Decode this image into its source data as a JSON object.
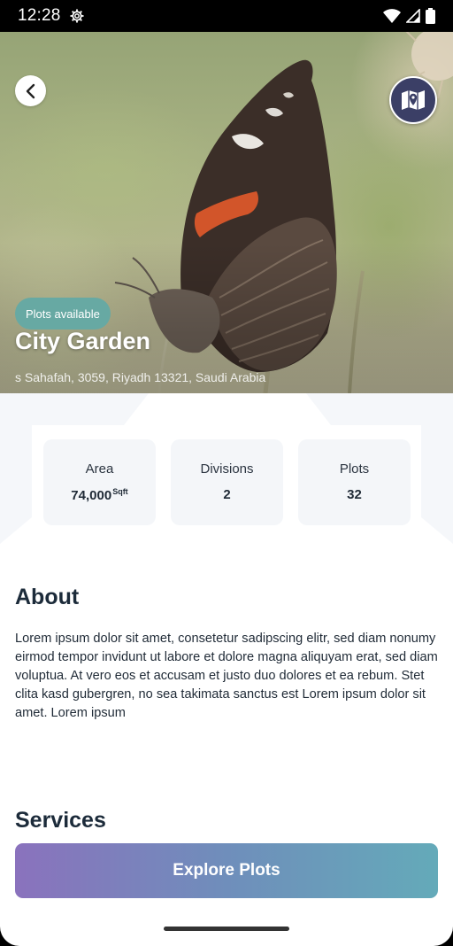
{
  "status_bar": {
    "time": "12:28",
    "icons": [
      "settings-gear-icon",
      "wifi-icon",
      "signal-icon",
      "battery-icon"
    ]
  },
  "hero": {
    "image": "butterfly-photo",
    "badge": "Plots available",
    "title": "City Garden",
    "address": "s Sahafah, 3059, Riyadh 13321, Saudi Arabia",
    "back_icon": "chevron-left-icon",
    "map_icon": "map-pin-icon"
  },
  "stats": [
    {
      "label": "Area",
      "value": "74,000",
      "unit": "Sqft"
    },
    {
      "label": "Divisions",
      "value": "2"
    },
    {
      "label": "Plots",
      "value": "32"
    }
  ],
  "about": {
    "heading": "About",
    "text": "Lorem ipsum dolor sit amet, consetetur sadipscing elitr, sed diam nonumy eirmod tempor invidunt ut labore et dolore magna aliquyam erat, sed diam voluptua. At vero eos et accusam et justo duo dolores et ea rebum. Stet clita kasd gubergren, no sea takimata sanctus est Lorem ipsum dolor sit amet. Lorem ipsum"
  },
  "services": {
    "heading": "Services"
  },
  "cta": {
    "label": "Explore Plots"
  },
  "colors": {
    "badge": "#67a9a3",
    "map_button": "#3b3f66",
    "heading": "#1c2b3a",
    "card_bg": "#f4f6f9",
    "cta_gradient_start": "#8a72bd",
    "cta_gradient_end": "#64aab9"
  }
}
